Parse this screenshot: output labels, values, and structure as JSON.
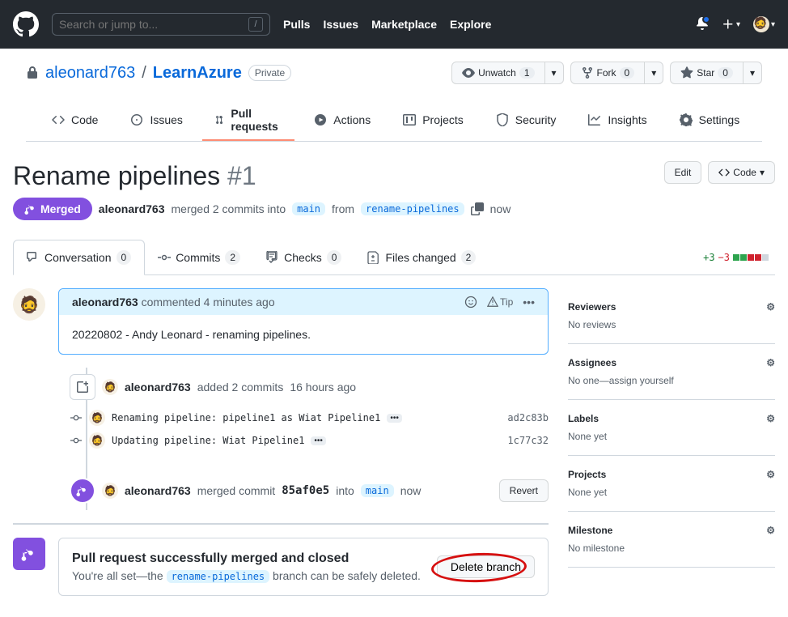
{
  "header": {
    "search_placeholder": "Search or jump to...",
    "nav": {
      "pulls": "Pulls",
      "issues": "Issues",
      "marketplace": "Marketplace",
      "explore": "Explore"
    }
  },
  "repo": {
    "owner": "aleonard763",
    "name": "LearnAzure",
    "visibility": "Private",
    "actions": {
      "unwatch": "Unwatch",
      "unwatch_count": "1",
      "fork": "Fork",
      "fork_count": "0",
      "star": "Star",
      "star_count": "0"
    },
    "nav": {
      "code": "Code",
      "issues": "Issues",
      "pulls": "Pull requests",
      "actions": "Actions",
      "projects": "Projects",
      "security": "Security",
      "insights": "Insights",
      "settings": "Settings"
    }
  },
  "pr": {
    "title": "Rename pipelines",
    "number": "#1",
    "edit": "Edit",
    "code_btn": "Code",
    "state": "Merged",
    "meta": {
      "author": "aleonard763",
      "text1": "merged 2 commits into",
      "base": "main",
      "text2": "from",
      "head": "rename-pipelines",
      "when": "now"
    },
    "tabs": {
      "conversation": "Conversation",
      "conversation_count": "0",
      "commits": "Commits",
      "commits_count": "2",
      "checks": "Checks",
      "checks_count": "0",
      "files": "Files changed",
      "files_count": "2"
    },
    "diff": {
      "add": "+3",
      "del": "−3"
    }
  },
  "comment": {
    "author": "aleonard763",
    "action": "commented",
    "when": "4 minutes ago",
    "tip": "Tip",
    "body": "20220802 - Andy Leonard - renaming pipelines."
  },
  "events": {
    "added": {
      "author": "aleonard763",
      "text": "added 2 commits",
      "when": "16 hours ago"
    },
    "commits": [
      {
        "msg": "Renaming pipeline: pipeline1 as Wiat Pipeline1",
        "sha": "ad2c83b"
      },
      {
        "msg": "Updating pipeline: Wiat Pipeline1",
        "sha": "1c77c32"
      }
    ],
    "merged": {
      "author": "aleonard763",
      "text1": "merged commit",
      "sha": "85af0e5",
      "text2": "into",
      "branch": "main",
      "when": "now"
    },
    "revert": "Revert"
  },
  "mergebox": {
    "title": "Pull request successfully merged and closed",
    "desc1": "You're all set—the ",
    "branch": "rename-pipelines",
    "desc2": " branch can be safely deleted.",
    "delete": "Delete branch"
  },
  "sidebar": {
    "reviewers": {
      "label": "Reviewers",
      "text": "No reviews"
    },
    "assignees": {
      "label": "Assignees",
      "text_pre": "No one—",
      "link": "assign yourself"
    },
    "labels": {
      "label": "Labels",
      "text": "None yet"
    },
    "projects": {
      "label": "Projects",
      "text": "None yet"
    },
    "milestone": {
      "label": "Milestone",
      "text": "No milestone"
    }
  }
}
